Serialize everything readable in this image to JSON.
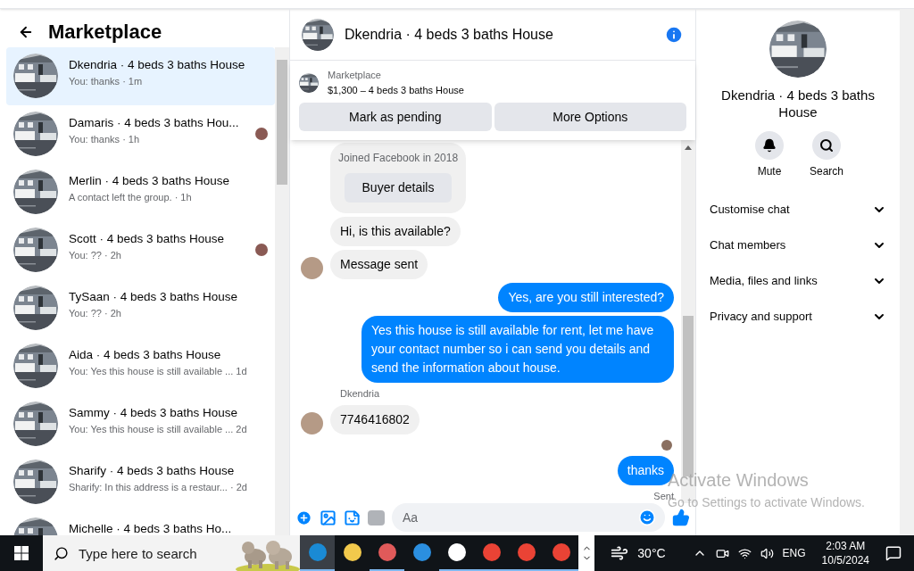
{
  "sidebar": {
    "title": "Marketplace",
    "conversations": [
      {
        "name": "Dkendria · 4 beds 3 baths House",
        "preview": "You: thanks · 1m",
        "selected": true,
        "seen_avatar": false
      },
      {
        "name": "Damaris · 4 beds 3 baths Hou...",
        "preview": "You: thanks · 1h",
        "selected": false,
        "seen_avatar": true
      },
      {
        "name": "Merlin · 4 beds 3 baths House",
        "preview": "A contact left the group. · 1h",
        "selected": false,
        "seen_avatar": false
      },
      {
        "name": "Scott · 4 beds 3 baths House",
        "preview": "You: ?? · 2h",
        "selected": false,
        "seen_avatar": true
      },
      {
        "name": "TySaan · 4 beds 3 baths House",
        "preview": "You: ?? · 2h",
        "selected": false,
        "seen_avatar": false
      },
      {
        "name": "Aida · 4 beds 3 baths House",
        "preview": "You: Yes this house is still available ... 1d",
        "selected": false,
        "seen_avatar": false
      },
      {
        "name": "Sammy · 4 beds 3 baths House",
        "preview": "You: Yes this house is still available ... 2d",
        "selected": false,
        "seen_avatar": false
      },
      {
        "name": "Sharify · 4 beds 3 baths House",
        "preview": "Sharify: In this address is a restaur... · 2d",
        "selected": false,
        "seen_avatar": false
      },
      {
        "name": "Michelle · 4 beds 3 baths Ho...",
        "selected": false,
        "seen_avatar": false
      }
    ]
  },
  "chat": {
    "title": "Dkendria · 4 beds 3 baths House",
    "listing": {
      "source": "Marketplace",
      "title": "$1,300 – 4 beds 3 baths House"
    },
    "actions": [
      "Mark as pending",
      "More Options"
    ],
    "messages": [
      {
        "kind": "card",
        "text": "Joined Facebook in 2018",
        "button": "Buyer details"
      },
      {
        "kind": "in",
        "text": "Hi, is this available?",
        "avatar": false
      },
      {
        "kind": "in",
        "text": "Message sent",
        "avatar": true
      },
      {
        "kind": "out",
        "text": "Yes, are you still interested?"
      },
      {
        "kind": "out",
        "text": "Yes this house is still available for rent, let me have your contact number so i can send you details and send the information about house."
      },
      {
        "kind": "sender",
        "text": "Dkendria"
      },
      {
        "kind": "in",
        "text": "7746416802",
        "avatar": true
      },
      {
        "kind": "receipt"
      },
      {
        "kind": "out",
        "text": "thanks"
      },
      {
        "kind": "status",
        "text": "Sent"
      }
    ],
    "composer": {
      "placeholder": "Aa"
    }
  },
  "details": {
    "title": "Dkendria · 4 beds 3 baths House",
    "actions": [
      {
        "kind": "mute",
        "label": "Mute"
      },
      {
        "kind": "search",
        "label": "Search"
      }
    ],
    "sections": [
      {
        "label": "Customise chat",
        "expanded": false
      },
      {
        "label": "Chat members",
        "expanded": false
      },
      {
        "label": "Media, files and links",
        "expanded": false
      },
      {
        "label": "Privacy and support",
        "expanded": false
      }
    ]
  },
  "watermark_overlay": {
    "title": "Activate Windows",
    "subtitle": "Go to Settings to activate Windows."
  },
  "taskbar": {
    "search": {
      "placeholder": "Type here to search"
    },
    "weather": "30°C",
    "language": "ENG",
    "time": "2:03 AM",
    "date": "10/5/2024"
  }
}
